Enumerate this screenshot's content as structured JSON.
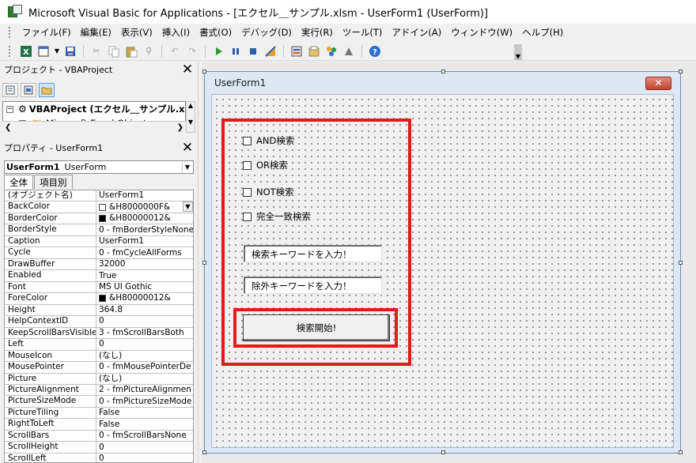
{
  "window": {
    "title": "Microsoft Visual Basic for Applications - [エクセル＿サンプル.xlsm - UserForm1 (UserForm)]"
  },
  "menu": [
    "ファイル(F)",
    "編集(E)",
    "表示(V)",
    "挿入(I)",
    "書式(O)",
    "デバッグ(D)",
    "実行(R)",
    "ツール(T)",
    "アドイン(A)",
    "ウィンドウ(W)",
    "ヘルプ(H)"
  ],
  "toolbar": {
    "icons": [
      "excel-icon",
      "insert-icon",
      "save-icon",
      "cut-icon",
      "copy-icon",
      "paste-icon",
      "find-icon",
      "undo-icon",
      "redo-icon",
      "run-icon",
      "break-icon",
      "reset-icon",
      "design-mode-icon",
      "project-explorer-icon",
      "properties-icon",
      "object-browser-icon",
      "toolbox-icon",
      "help-icon"
    ]
  },
  "project_pane": {
    "title": "プロジェクト - VBAProject",
    "close": "✕",
    "tree": [
      {
        "label": "VBAProject (エクセル＿サンプル.xls",
        "toggle": "−"
      },
      {
        "label": "Microsoft Excel Objects",
        "toggle": "+"
      }
    ]
  },
  "properties_pane": {
    "title": "プロパティ - UserForm1",
    "close": "✕",
    "object_name": "UserForm1",
    "object_type": "UserForm",
    "tabs": [
      "全体",
      "項目別"
    ],
    "rows": [
      {
        "name": "(オブジェクト名)",
        "value": "UserForm1"
      },
      {
        "name": "BackColor",
        "value": "&H8000000F&",
        "swatch": "#ffffff",
        "dropdown": true
      },
      {
        "name": "BorderColor",
        "value": "&H80000012&",
        "swatch": "#000000"
      },
      {
        "name": "BorderStyle",
        "value": "0 - fmBorderStyleNone"
      },
      {
        "name": "Caption",
        "value": "UserForm1"
      },
      {
        "name": "Cycle",
        "value": "0 - fmCycleAllForms"
      },
      {
        "name": "DrawBuffer",
        "value": "32000"
      },
      {
        "name": "Enabled",
        "value": "True"
      },
      {
        "name": "Font",
        "value": "MS UI Gothic"
      },
      {
        "name": "ForeColor",
        "value": "&H80000012&",
        "swatch": "#000000"
      },
      {
        "name": "Height",
        "value": "364.8"
      },
      {
        "name": "HelpContextID",
        "value": "0"
      },
      {
        "name": "KeepScrollBarsVisible",
        "value": "3 - fmScrollBarsBoth"
      },
      {
        "name": "Left",
        "value": "0"
      },
      {
        "name": "MouseIcon",
        "value": "(なし)"
      },
      {
        "name": "MousePointer",
        "value": "0 - fmMousePointerDe"
      },
      {
        "name": "Picture",
        "value": "(なし)"
      },
      {
        "name": "PictureAlignment",
        "value": "2 - fmPictureAlignmen"
      },
      {
        "name": "PictureSizeMode",
        "value": "0 - fmPictureSizeMode"
      },
      {
        "name": "PictureTiling",
        "value": "False"
      },
      {
        "name": "RightToLeft",
        "value": "False"
      },
      {
        "name": "ScrollBars",
        "value": "0 - fmScrollBarsNone"
      },
      {
        "name": "ScrollHeight",
        "value": "0"
      },
      {
        "name": "ScrollLeft",
        "value": "0"
      }
    ]
  },
  "userform": {
    "caption": "UserForm1",
    "close": "✕",
    "checkboxes": [
      "AND検索",
      "OR検索",
      "NOT検索",
      "完全一致検索"
    ],
    "textboxes": [
      "検索キーワードを入力！",
      "除外キーワードを入力！"
    ],
    "button": "検索開始!"
  },
  "colors": {
    "highlight": "#e01b1b",
    "form_frame": "#dee8f5"
  }
}
